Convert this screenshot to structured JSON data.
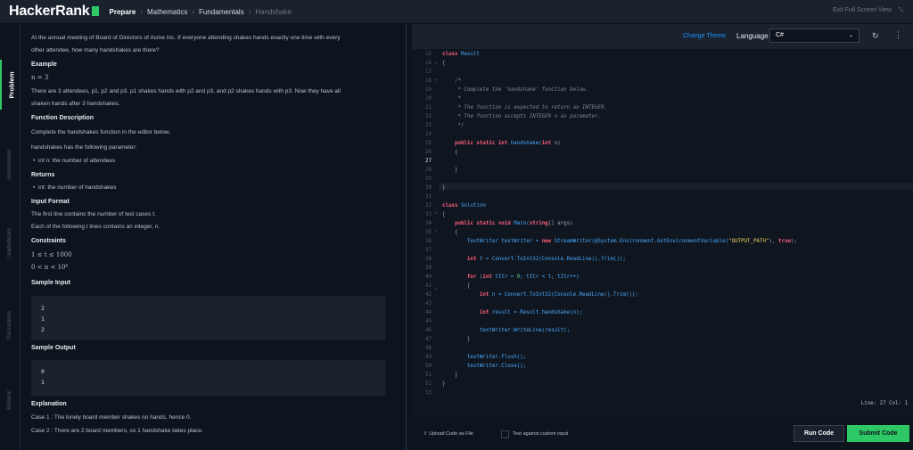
{
  "topbar": {
    "logo": "HackerRank",
    "breadcrumb": [
      "Prepare",
      "Mathematics",
      "Fundamentals",
      "Handshake"
    ],
    "exit_label": "Exit Full Screen View"
  },
  "sidetabs": [
    "Problem",
    "Submissions",
    "Leaderboard",
    "Discussions",
    "Editorial"
  ],
  "problem": {
    "intro_1": "At the annual meeting of Board of Directors of Acme Inc. If everyone attending shakes hands exactly one time with every",
    "intro_2": "other attendee, how many handshakes are there?",
    "example_heading": "Example",
    "example_n": "n = 3",
    "example_text_1": "There are 3 attendees, p1, p2 and p3. p1 shakes hands with p2 and p3, and p2 shakes hands with p3. Now they have all",
    "example_text_2": "shaken hands after 3 handshakes.",
    "func_heading": "Function Description",
    "func_text": "Complete the handshakes function in the editor below.",
    "param_intro": "handshakes has the following parameter:",
    "param_1": "int n: the number of attendees",
    "returns_heading": "Returns",
    "returns_1": "int: the number of handshakes",
    "input_heading": "Input Format",
    "input_1": "The first line contains the number of test cases t.",
    "input_2": "Each of the following t lines contains an integer, n.",
    "constraints_heading": "Constraints",
    "constraint_1": "1 ≤ t ≤ 1000",
    "constraint_2": "0 < n < 10⁶",
    "sample_input_heading": "Sample Input",
    "sample_input": [
      "2",
      "1",
      "2"
    ],
    "sample_output_heading": "Sample Output",
    "sample_output": [
      "0",
      "1"
    ],
    "explanation_heading": "Explanation",
    "explanation_1": "Case 1 : The lonely board member shakes no hands, hence 0.",
    "explanation_2": "Case 2 : There are 2 board members, so 1 handshake takes place."
  },
  "editor": {
    "change_theme": "Change Theme",
    "language_label": "Language",
    "language_value": "C#",
    "status": "Line: 27 Col: 1",
    "current_line": "27",
    "line_numbers": [
      "15",
      "16",
      "17",
      "18",
      "19",
      "20",
      "21",
      "22",
      "23",
      "24",
      "25",
      "26",
      "27",
      "28",
      "29",
      "30",
      "31",
      "32",
      "33",
      "34",
      "35",
      "36",
      "37",
      "38",
      "39",
      "40",
      "41",
      "42",
      "43",
      "44",
      "45",
      "46",
      "47",
      "48",
      "49",
      "50",
      "51",
      "52",
      "53"
    ],
    "code": {
      "l15": [
        "class",
        " Result"
      ],
      "l16": "{",
      "l18": "    /*",
      "l19": "     * Complete the 'handshake' function below.",
      "l20": "     *",
      "l21": "     * The function is expected to return an INTEGER.",
      "l22": "     * The function accepts INTEGER n as parameter.",
      "l23": "     */",
      "l25_kw": "    public static int",
      "l25_rest": " handshake(",
      "l25_kw2": "int",
      "l25_end": " n)",
      "l26": "    {",
      "l28": "    }",
      "l30": "}",
      "l32": [
        "class",
        " Solution"
      ],
      "l33": "{",
      "l34_kw": "    public static void",
      "l34_rest": " Main(",
      "l34_kw2": "string",
      "l34_end": "[] args)",
      "l35": "    {",
      "l36_a": "        TextWriter textWriter = ",
      "l36_new": "new",
      "l36_b": " StreamWriter(@System.Environment.GetEnvironmentVariable(",
      "l36_str": "\"OUTPUT_PATH\"",
      "l36_c": "), ",
      "l36_true": "true",
      "l36_d": ");",
      "l38_kw": "        int",
      "l38_rest": " t = Convert.ToInt32(Console.ReadLine().Trim());",
      "l40_kw": "        for",
      "l40_a": " (",
      "l40_int": "int",
      "l40_b": " tItr = ",
      "l40_zero": "0",
      "l40_c": "; tItr < t; tItr++)",
      "l41": "        {",
      "l42_kw": "            int",
      "l42_rest": " n = Convert.ToInt32(Console.ReadLine().Trim());",
      "l44_kw": "            int",
      "l44_rest": " result = Result.handshake(n);",
      "l46": "            textWriter.WriteLine(result);",
      "l47": "        }",
      "l49": "        textWriter.Flush();",
      "l50": "        textWriter.Close();",
      "l51": "    }",
      "l52": "}"
    }
  },
  "footer": {
    "upload": "Upload Code as File",
    "custom_input": "Test against custom input",
    "run": "Run Code",
    "submit": "Submit Code"
  },
  "colors": {
    "accent": "#2ec866",
    "link": "#1b90ff",
    "keyword": "#ff5e7c"
  }
}
